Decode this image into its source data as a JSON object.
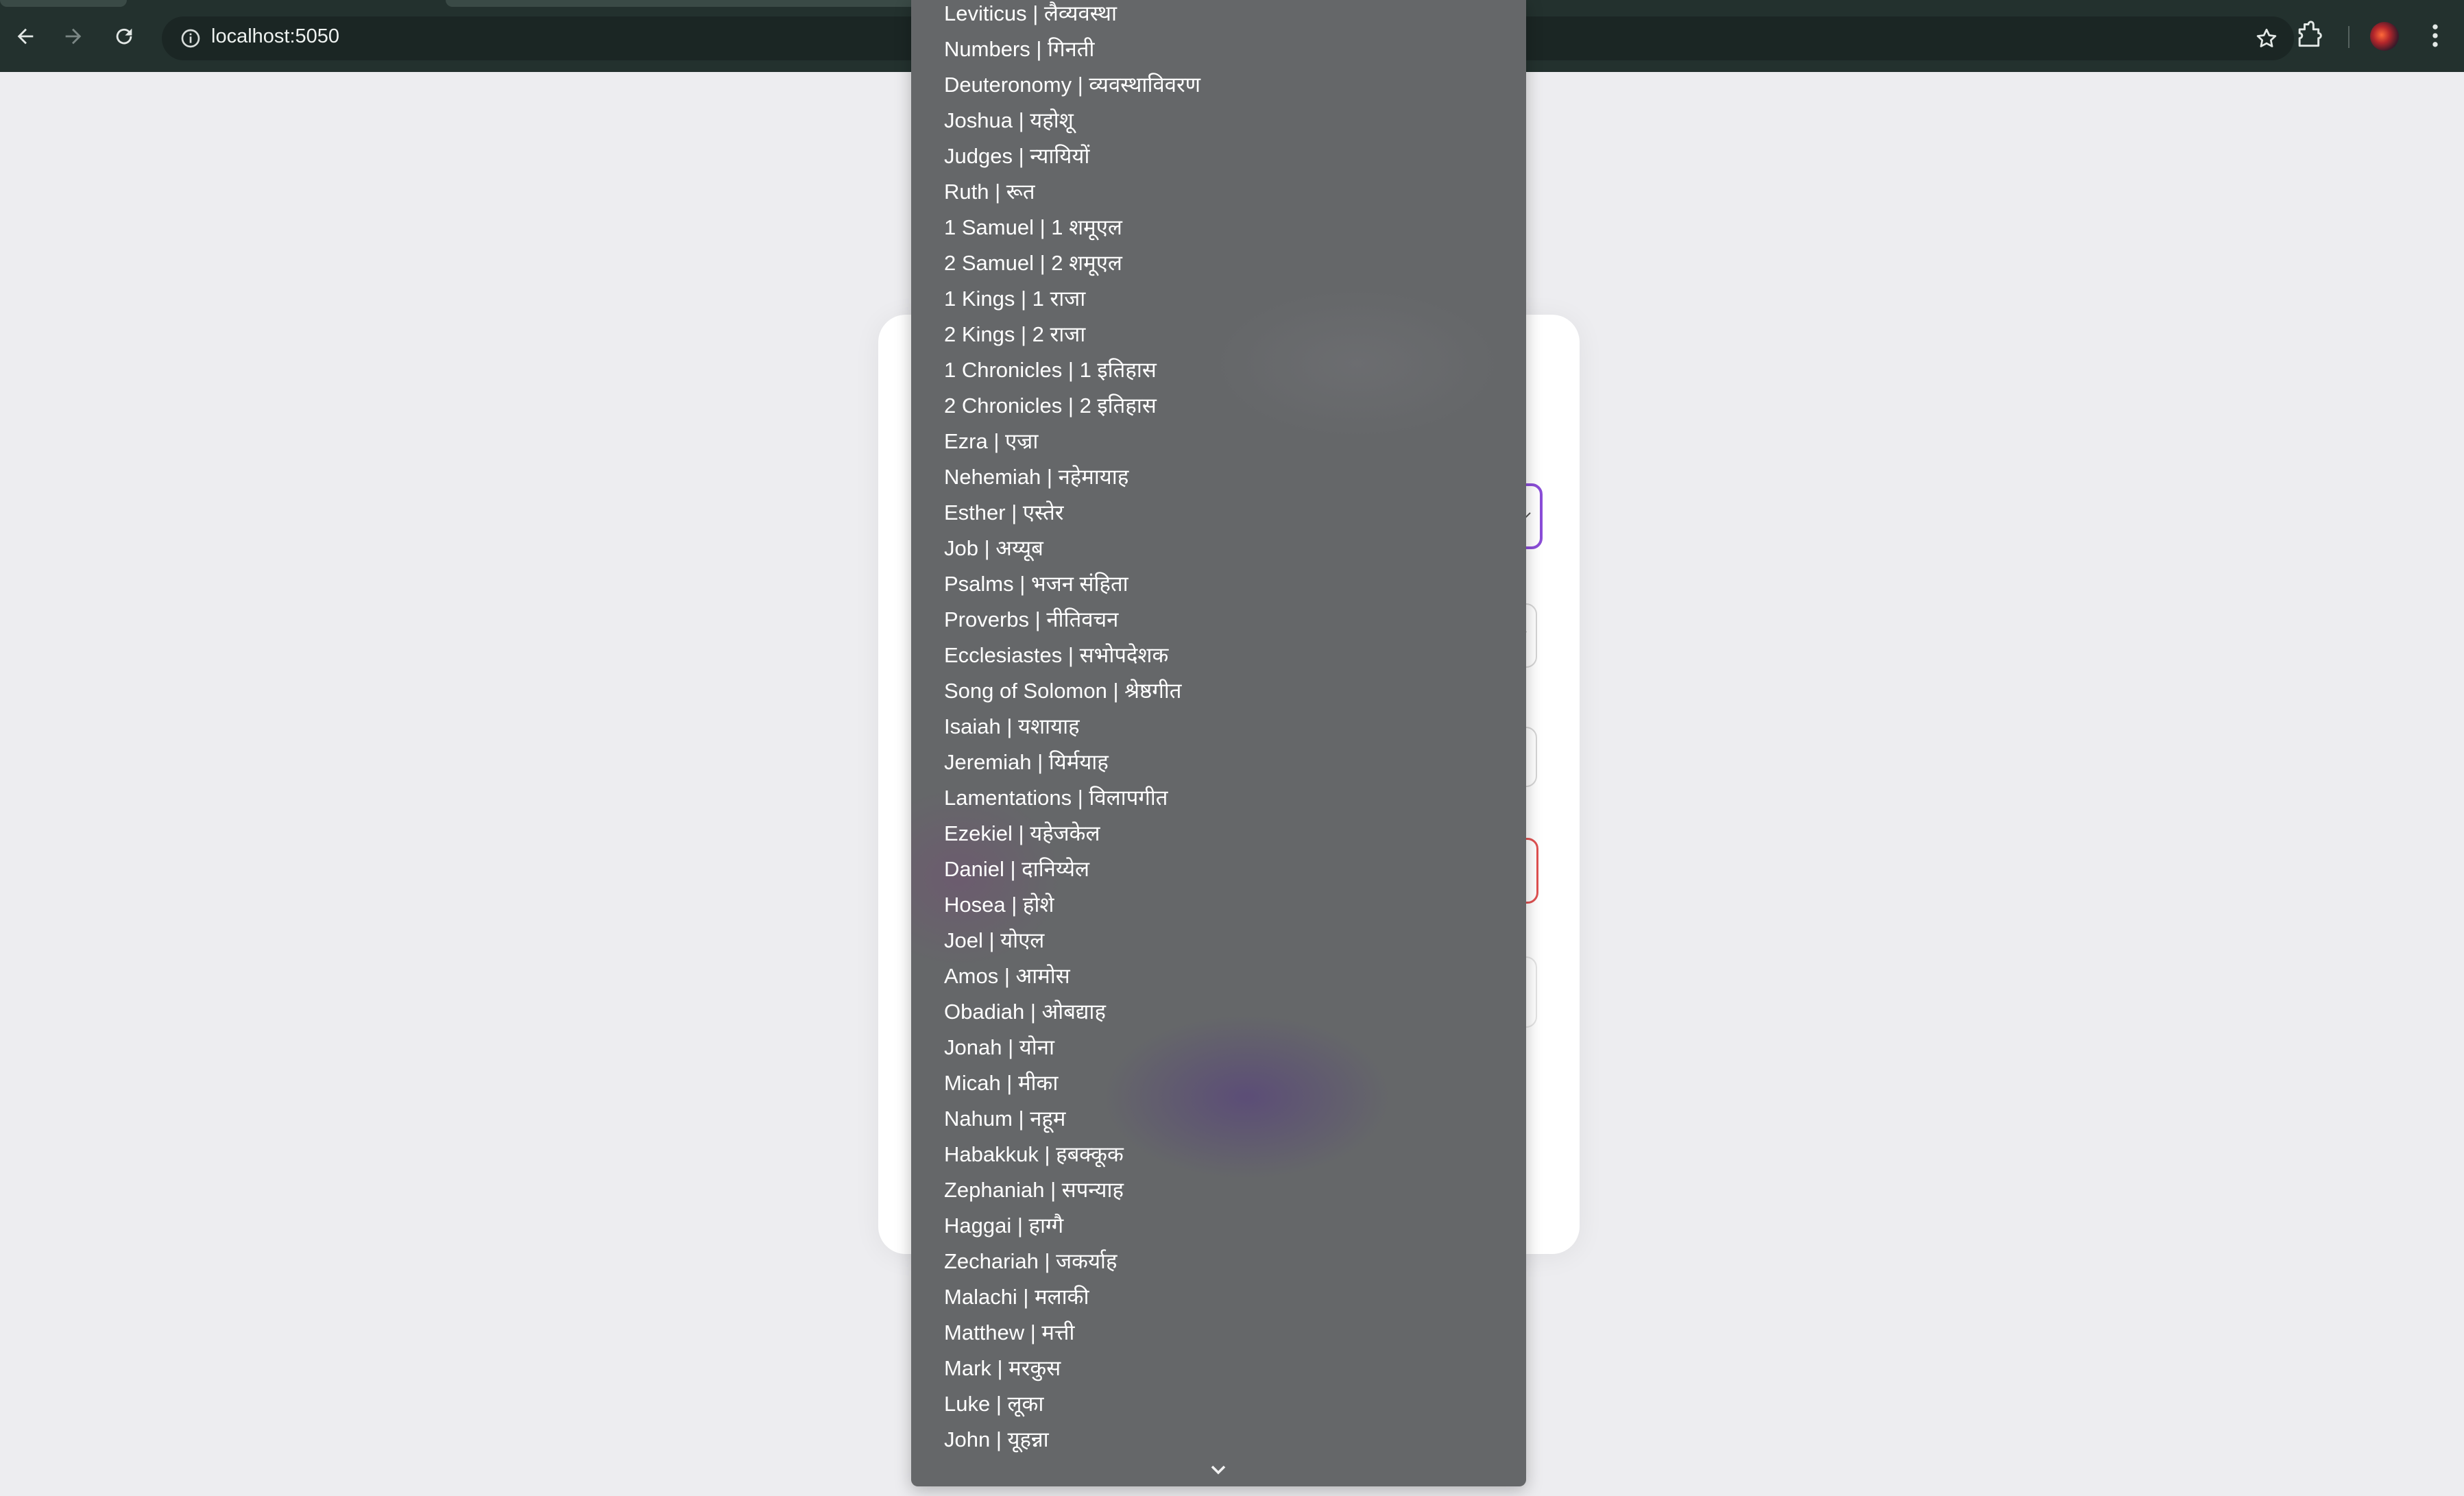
{
  "browser": {
    "url": "localhost:5050",
    "icons": [
      "back-arrow-icon",
      "forward-arrow-icon",
      "reload-icon",
      "info-icon",
      "star-icon",
      "extensions-icon",
      "avatar",
      "kebab-menu-icon"
    ]
  },
  "dropdown": {
    "options": [
      "Leviticus | लैव्यवस्था",
      "Numbers | गिनती",
      "Deuteronomy | व्यवस्थाविवरण",
      "Joshua | यहोशू",
      "Judges | न्यायियों",
      "Ruth | रूत",
      "1 Samuel | 1 शमूएल",
      "2 Samuel | 2 शमूएल",
      "1 Kings | 1 राजा",
      "2 Kings | 2 राजा",
      "1 Chronicles | 1 इतिहास",
      "2 Chronicles | 2 इतिहास",
      "Ezra | एज्रा",
      "Nehemiah | नहेमायाह",
      "Esther | एस्तेर",
      "Job | अय्यूब",
      "Psalms | भजन संहिता",
      "Proverbs | नीतिवचन",
      "Ecclesiastes | सभोपदेशक",
      "Song of Solomon | श्रेष्ठगीत",
      "Isaiah | यशायाह",
      "Jeremiah | यिर्मयाह",
      "Lamentations | विलापगीत",
      "Ezekiel | यहेजकेल",
      "Daniel | दानिय्येल",
      "Hosea | होशे",
      "Joel | योएल",
      "Amos | आमोस",
      "Obadiah | ओबद्याह",
      "Jonah | योना",
      "Micah | मीका",
      "Nahum | नहूम",
      "Habakkuk | हबक्कूक",
      "Zephaniah | सपन्याह",
      "Haggai | हाग्गै",
      "Zechariah | जकर्याह",
      "Malachi | मलाकी",
      "Matthew | मत्ती",
      "Mark | मरकुस",
      "Luke | लूका",
      "John | यूहन्ना"
    ]
  },
  "colors": {
    "chrome_bg": "#23312e",
    "page_bg": "#ededf0",
    "dropdown_bg": "#656769",
    "focus_accent": "#8b4ed8",
    "error_accent": "#e05252"
  }
}
